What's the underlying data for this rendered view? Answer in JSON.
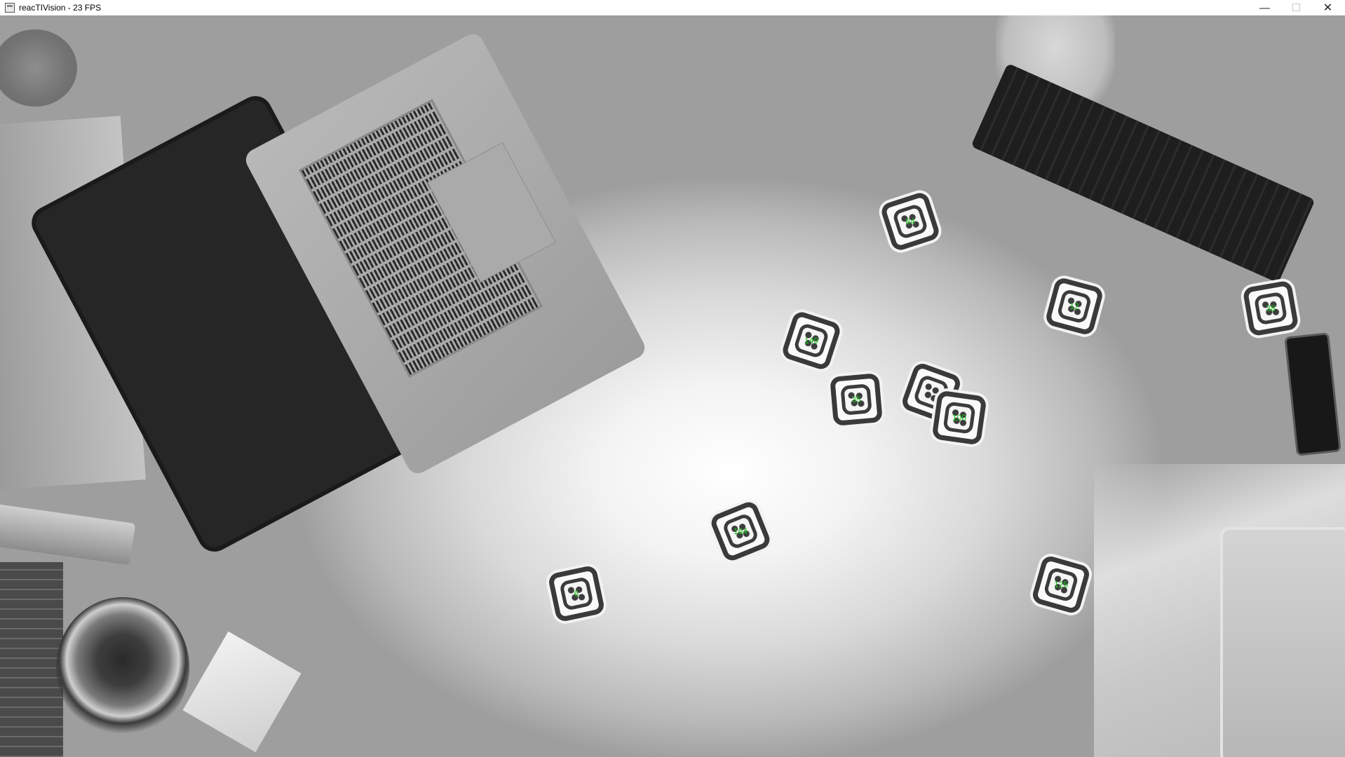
{
  "window": {
    "title": "reacTIVision - 23 FPS",
    "icon": "app-window-icon",
    "controls": {
      "minimize_icon": "minimize-icon",
      "maximize_icon": "maximize-icon",
      "close_icon": "close-icon"
    }
  },
  "camera": {
    "mode": "grayscale-live-feed",
    "fiducial_label_color": "#19c419"
  },
  "fiducials": [
    {
      "id": "84"
    },
    {
      "id": "12"
    },
    {
      "id": "38"
    },
    {
      "id": "149"
    },
    {
      "id": "35"
    },
    {
      "id": "100"
    },
    {
      "id": "164"
    },
    {
      "id": "6"
    },
    {
      "id": "125"
    }
  ]
}
